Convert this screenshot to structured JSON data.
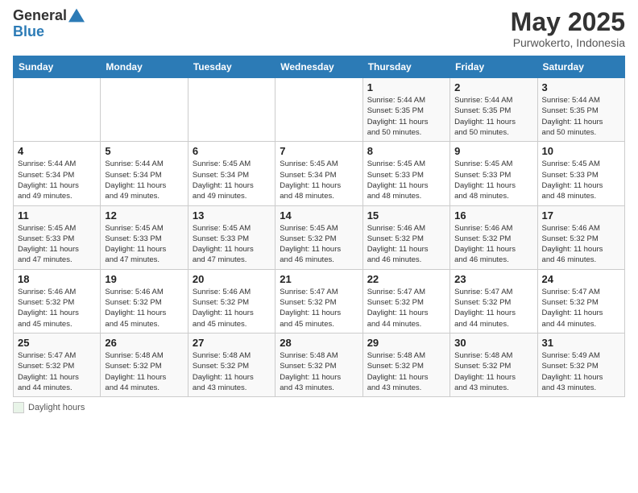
{
  "header": {
    "logo_general": "General",
    "logo_blue": "Blue",
    "main_title": "May 2025",
    "subtitle": "Purwokerto, Indonesia"
  },
  "footer": {
    "daylight_label": "Daylight hours"
  },
  "days_of_week": [
    "Sunday",
    "Monday",
    "Tuesday",
    "Wednesday",
    "Thursday",
    "Friday",
    "Saturday"
  ],
  "weeks": [
    [
      {
        "day": "",
        "info": ""
      },
      {
        "day": "",
        "info": ""
      },
      {
        "day": "",
        "info": ""
      },
      {
        "day": "",
        "info": ""
      },
      {
        "day": "1",
        "info": "Sunrise: 5:44 AM\nSunset: 5:35 PM\nDaylight: 11 hours\nand 50 minutes."
      },
      {
        "day": "2",
        "info": "Sunrise: 5:44 AM\nSunset: 5:35 PM\nDaylight: 11 hours\nand 50 minutes."
      },
      {
        "day": "3",
        "info": "Sunrise: 5:44 AM\nSunset: 5:35 PM\nDaylight: 11 hours\nand 50 minutes."
      }
    ],
    [
      {
        "day": "4",
        "info": "Sunrise: 5:44 AM\nSunset: 5:34 PM\nDaylight: 11 hours\nand 49 minutes."
      },
      {
        "day": "5",
        "info": "Sunrise: 5:44 AM\nSunset: 5:34 PM\nDaylight: 11 hours\nand 49 minutes."
      },
      {
        "day": "6",
        "info": "Sunrise: 5:45 AM\nSunset: 5:34 PM\nDaylight: 11 hours\nand 49 minutes."
      },
      {
        "day": "7",
        "info": "Sunrise: 5:45 AM\nSunset: 5:34 PM\nDaylight: 11 hours\nand 48 minutes."
      },
      {
        "day": "8",
        "info": "Sunrise: 5:45 AM\nSunset: 5:33 PM\nDaylight: 11 hours\nand 48 minutes."
      },
      {
        "day": "9",
        "info": "Sunrise: 5:45 AM\nSunset: 5:33 PM\nDaylight: 11 hours\nand 48 minutes."
      },
      {
        "day": "10",
        "info": "Sunrise: 5:45 AM\nSunset: 5:33 PM\nDaylight: 11 hours\nand 48 minutes."
      }
    ],
    [
      {
        "day": "11",
        "info": "Sunrise: 5:45 AM\nSunset: 5:33 PM\nDaylight: 11 hours\nand 47 minutes."
      },
      {
        "day": "12",
        "info": "Sunrise: 5:45 AM\nSunset: 5:33 PM\nDaylight: 11 hours\nand 47 minutes."
      },
      {
        "day": "13",
        "info": "Sunrise: 5:45 AM\nSunset: 5:33 PM\nDaylight: 11 hours\nand 47 minutes."
      },
      {
        "day": "14",
        "info": "Sunrise: 5:45 AM\nSunset: 5:32 PM\nDaylight: 11 hours\nand 46 minutes."
      },
      {
        "day": "15",
        "info": "Sunrise: 5:46 AM\nSunset: 5:32 PM\nDaylight: 11 hours\nand 46 minutes."
      },
      {
        "day": "16",
        "info": "Sunrise: 5:46 AM\nSunset: 5:32 PM\nDaylight: 11 hours\nand 46 minutes."
      },
      {
        "day": "17",
        "info": "Sunrise: 5:46 AM\nSunset: 5:32 PM\nDaylight: 11 hours\nand 46 minutes."
      }
    ],
    [
      {
        "day": "18",
        "info": "Sunrise: 5:46 AM\nSunset: 5:32 PM\nDaylight: 11 hours\nand 45 minutes."
      },
      {
        "day": "19",
        "info": "Sunrise: 5:46 AM\nSunset: 5:32 PM\nDaylight: 11 hours\nand 45 minutes."
      },
      {
        "day": "20",
        "info": "Sunrise: 5:46 AM\nSunset: 5:32 PM\nDaylight: 11 hours\nand 45 minutes."
      },
      {
        "day": "21",
        "info": "Sunrise: 5:47 AM\nSunset: 5:32 PM\nDaylight: 11 hours\nand 45 minutes."
      },
      {
        "day": "22",
        "info": "Sunrise: 5:47 AM\nSunset: 5:32 PM\nDaylight: 11 hours\nand 44 minutes."
      },
      {
        "day": "23",
        "info": "Sunrise: 5:47 AM\nSunset: 5:32 PM\nDaylight: 11 hours\nand 44 minutes."
      },
      {
        "day": "24",
        "info": "Sunrise: 5:47 AM\nSunset: 5:32 PM\nDaylight: 11 hours\nand 44 minutes."
      }
    ],
    [
      {
        "day": "25",
        "info": "Sunrise: 5:47 AM\nSunset: 5:32 PM\nDaylight: 11 hours\nand 44 minutes."
      },
      {
        "day": "26",
        "info": "Sunrise: 5:48 AM\nSunset: 5:32 PM\nDaylight: 11 hours\nand 44 minutes."
      },
      {
        "day": "27",
        "info": "Sunrise: 5:48 AM\nSunset: 5:32 PM\nDaylight: 11 hours\nand 43 minutes."
      },
      {
        "day": "28",
        "info": "Sunrise: 5:48 AM\nSunset: 5:32 PM\nDaylight: 11 hours\nand 43 minutes."
      },
      {
        "day": "29",
        "info": "Sunrise: 5:48 AM\nSunset: 5:32 PM\nDaylight: 11 hours\nand 43 minutes."
      },
      {
        "day": "30",
        "info": "Sunrise: 5:48 AM\nSunset: 5:32 PM\nDaylight: 11 hours\nand 43 minutes."
      },
      {
        "day": "31",
        "info": "Sunrise: 5:49 AM\nSunset: 5:32 PM\nDaylight: 11 hours\nand 43 minutes."
      }
    ]
  ]
}
